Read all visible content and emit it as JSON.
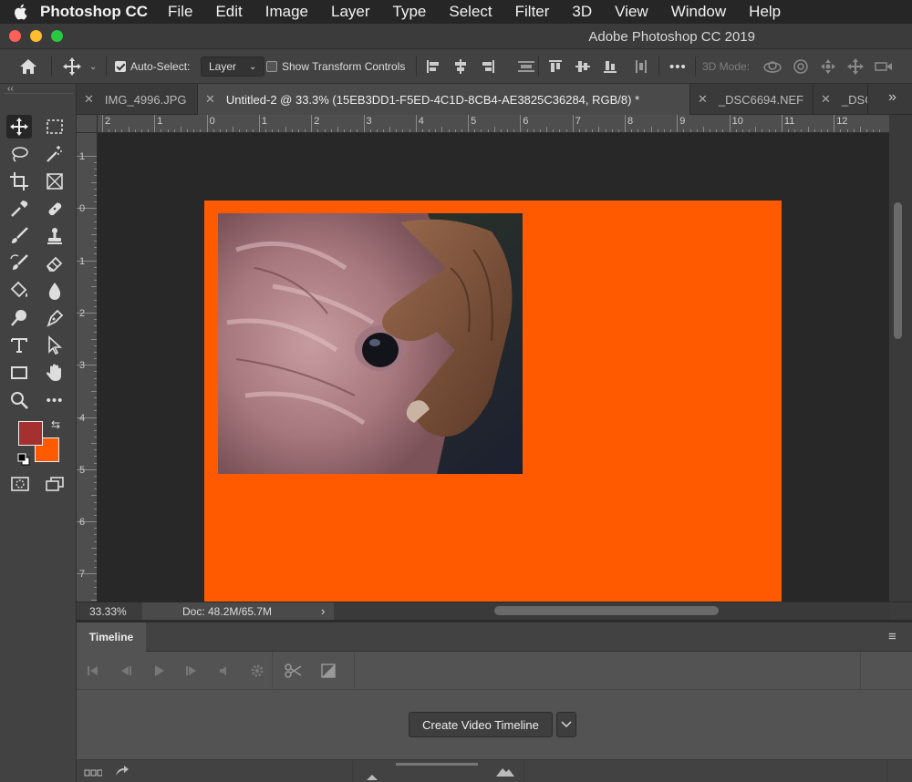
{
  "menubar": {
    "app_name": "Photoshop CC",
    "items": [
      "File",
      "Edit",
      "Image",
      "Layer",
      "Type",
      "Select",
      "Filter",
      "3D",
      "View",
      "Window",
      "Help"
    ]
  },
  "window": {
    "title": "Adobe Photoshop CC 2019"
  },
  "options_bar": {
    "auto_select_label": "Auto-Select:",
    "auto_select_checked": true,
    "auto_select_target": "Layer",
    "transform_label": "Show Transform Controls",
    "transform_checked": false,
    "mode_3d_label": "3D Mode:",
    "more_label": "•••"
  },
  "tabs": [
    {
      "label": "IMG_4996.JPG",
      "active": false
    },
    {
      "label": "Untitled-2 @ 33.3% (15EB3DD1-F5ED-4C1D-8CB4-AE3825C36284, RGB/8) *",
      "active": true
    },
    {
      "label": "_DSC6694.NEF",
      "active": false
    },
    {
      "label": "_DSC",
      "active": false
    }
  ],
  "tabs_overflow": "»",
  "ruler": {
    "h_labels": [
      "2",
      "1",
      "0",
      "1",
      "2",
      "3",
      "4",
      "5",
      "6",
      "7",
      "8",
      "9",
      "10",
      "11",
      "12"
    ],
    "v_labels": [
      "1",
      "0",
      "1",
      "2",
      "3",
      "4",
      "5",
      "6",
      "7"
    ]
  },
  "toolbar": {
    "collapse_label": "‹‹",
    "foreground_color": "#a4302f",
    "background_color": "#ff5a00"
  },
  "document": {
    "background_color": "#ff5a00"
  },
  "status": {
    "zoom": "33.33%",
    "doc_size": "Doc: 48.2M/65.7M",
    "arrow": "›"
  },
  "timeline": {
    "title": "Timeline",
    "create_button": "Create Video Timeline",
    "menu_icon": "≡"
  }
}
